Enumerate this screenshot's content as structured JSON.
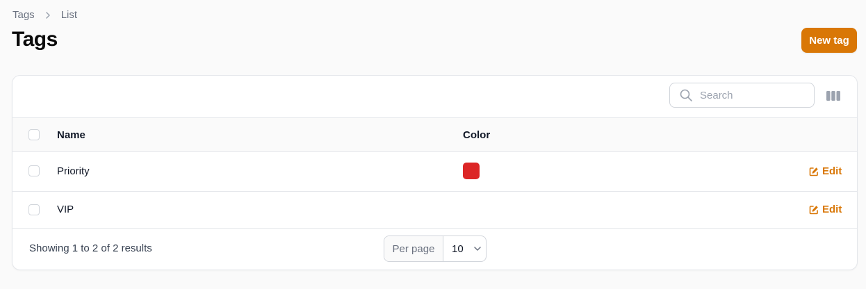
{
  "breadcrumb": {
    "items": [
      {
        "label": "Tags"
      },
      {
        "label": "List"
      }
    ]
  },
  "page": {
    "title": "Tags",
    "new_button_label": "New tag"
  },
  "table": {
    "search": {
      "placeholder": "Search",
      "value": ""
    },
    "columns": [
      "Name",
      "Color"
    ],
    "rows": [
      {
        "name": "Priority",
        "color": "#dc2626",
        "action": "Edit"
      },
      {
        "name": "VIP",
        "color": "",
        "action": "Edit"
      }
    ],
    "footer": {
      "summary": "Showing 1 to 2 of 2 results",
      "per_page_label": "Per page",
      "per_page_value": "10"
    }
  },
  "theme": {
    "accent": "#d97706",
    "background": "#fafafa"
  }
}
